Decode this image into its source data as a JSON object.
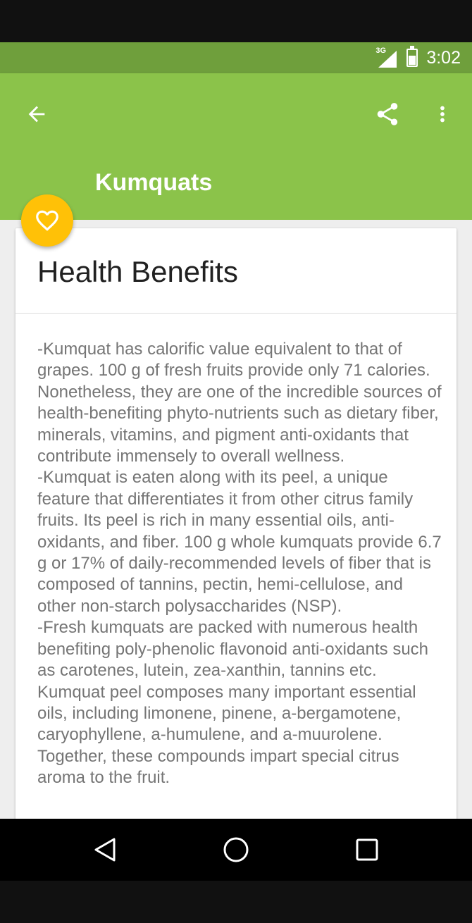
{
  "status_bar": {
    "network": "3G",
    "time": "3:02"
  },
  "toolbar": {
    "title": "Kumquats",
    "icons": [
      "arrow-back-icon",
      "share-icon",
      "more-vert-icon"
    ]
  },
  "fab": {
    "icon": "heart-outline-icon"
  },
  "card": {
    "title": "Health Benefits",
    "paragraphs": [
      "-Kumquat has calorific value equivalent to that of grapes. 100 g of fresh fruits provide only 71 calories. Nonetheless, they are one of the incredible sources of health-benefiting phyto-nutrients such as dietary fiber, minerals, vitamins, and pigment anti-oxidants that contribute immensely to overall wellness.",
      "-Kumquat is eaten along with its peel, a unique feature that differentiates it from other citrus family fruits. Its peel is rich in many essential oils, anti-oxidants, and fiber. 100 g whole kumquats provide 6.7 g or 17% of daily-recommended levels of fiber that is composed of tannins, pectin, hemi-cellulose, and other non-starch polysaccharides (NSP).",
      "-Fresh kumquats are packed with numerous health benefiting poly-phenolic flavonoid anti-oxidants such as carotenes, lutein, zea-xanthin, tannins etc. Kumquat peel composes many important essential oils, including limonene, pinene, a-bergamotene, caryophyllene, a-humulene, and a-muurolene. Together, these compounds impart special citrus aroma to the fruit."
    ]
  },
  "nav_bar": {
    "icons": [
      "nav-back-icon",
      "nav-home-icon",
      "nav-recents-icon"
    ]
  },
  "colors": {
    "status_bar": "#6f9f3c",
    "app_bar": "#8bc34a",
    "fab": "#ffc107",
    "body_text": "#757575"
  }
}
